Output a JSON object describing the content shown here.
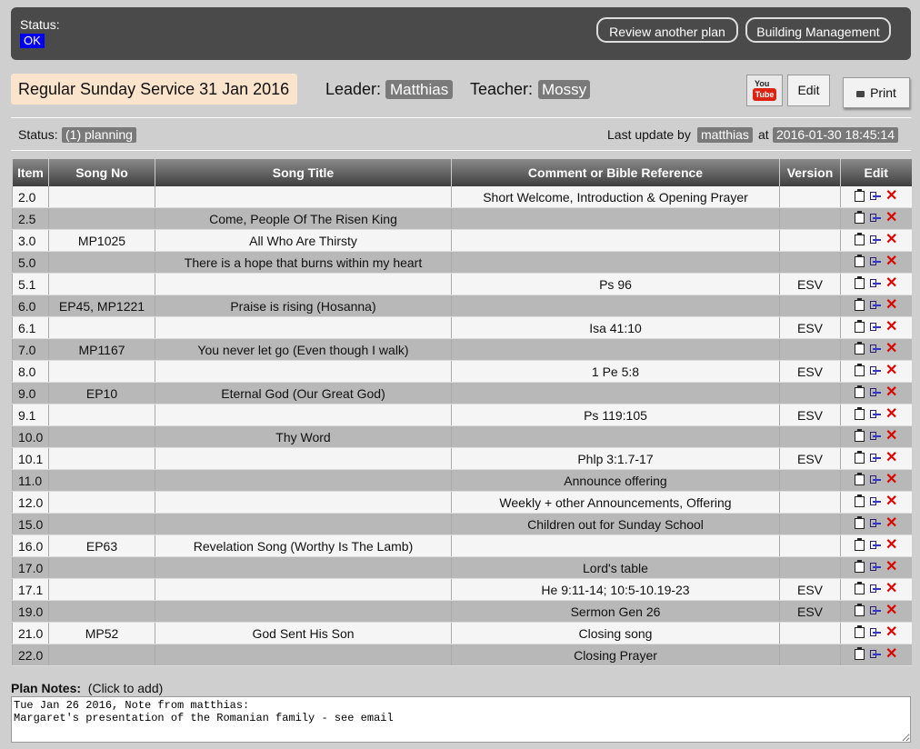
{
  "top": {
    "status_label": "Status:",
    "status_value": "OK",
    "review_button": "Review another plan",
    "building_button": "Building Management"
  },
  "header": {
    "service_title": "Regular Sunday Service 31 Jan 2016",
    "leader_label": "Leader:",
    "leader": "Matthias",
    "teacher_label": "Teacher:",
    "teacher": "Mossy",
    "youtube_icon_top": "You",
    "youtube_icon_bottom": "Tube",
    "edit_button": "Edit",
    "print_button": "Print"
  },
  "status_bar": {
    "label": "Status:",
    "value": "(1) planning",
    "last_update_label": "Last update by",
    "last_update_user": "matthias",
    "at_label": "at",
    "last_update_time": "2016-01-30 18:45:14"
  },
  "table": {
    "headers": [
      "Item",
      "Song No",
      "Song Title",
      "Comment or Bible Reference",
      "Version",
      "Edit"
    ],
    "rows": [
      {
        "item": "2.0",
        "song_no": "",
        "title": "",
        "comment": "Short Welcome, Introduction & Opening Prayer",
        "version": ""
      },
      {
        "item": "2.5",
        "song_no": "",
        "title": "Come, People Of The Risen King",
        "comment": "",
        "version": ""
      },
      {
        "item": "3.0",
        "song_no": "MP1025",
        "title": "All Who Are Thirsty",
        "comment": "",
        "version": ""
      },
      {
        "item": "5.0",
        "song_no": "",
        "title": "There is a hope that burns within my heart",
        "comment": "",
        "version": ""
      },
      {
        "item": "5.1",
        "song_no": "",
        "title": "",
        "comment": "Ps 96",
        "version": "ESV"
      },
      {
        "item": "6.0",
        "song_no": "EP45, MP1221",
        "title": "Praise is rising (Hosanna)",
        "comment": "",
        "version": ""
      },
      {
        "item": "6.1",
        "song_no": "",
        "title": "",
        "comment": "Isa 41:10",
        "version": "ESV"
      },
      {
        "item": "7.0",
        "song_no": "MP1167",
        "title": "You never let go (Even though I walk)",
        "comment": "",
        "version": ""
      },
      {
        "item": "8.0",
        "song_no": "",
        "title": "",
        "comment": "1 Pe 5:8",
        "version": "ESV"
      },
      {
        "item": "9.0",
        "song_no": "EP10",
        "title": "Eternal God (Our Great God)",
        "comment": "",
        "version": ""
      },
      {
        "item": "9.1",
        "song_no": "",
        "title": "",
        "comment": "Ps 119:105",
        "version": "ESV"
      },
      {
        "item": "10.0",
        "song_no": "",
        "title": "Thy Word",
        "comment": "",
        "version": ""
      },
      {
        "item": "10.1",
        "song_no": "",
        "title": "",
        "comment": "Phlp 3:1.7-17",
        "version": "ESV"
      },
      {
        "item": "11.0",
        "song_no": "",
        "title": "",
        "comment": "Announce offering",
        "version": ""
      },
      {
        "item": "12.0",
        "song_no": "",
        "title": "",
        "comment": "Weekly + other Announcements, Offering",
        "version": ""
      },
      {
        "item": "15.0",
        "song_no": "",
        "title": "",
        "comment": "Children out for Sunday School",
        "version": ""
      },
      {
        "item": "16.0",
        "song_no": "EP63",
        "title": "Revelation Song (Worthy Is The Lamb)",
        "comment": "",
        "version": ""
      },
      {
        "item": "17.0",
        "song_no": "",
        "title": "",
        "comment": "Lord's table",
        "version": ""
      },
      {
        "item": "17.1",
        "song_no": "",
        "title": "",
        "comment": "He 9:11-14; 10:5-10.19-23",
        "version": "ESV"
      },
      {
        "item": "19.0",
        "song_no": "",
        "title": "",
        "comment": "Sermon Gen 26",
        "version": "ESV"
      },
      {
        "item": "21.0",
        "song_no": "MP52",
        "title": "God Sent His Son",
        "comment": "Closing song",
        "version": ""
      },
      {
        "item": "22.0",
        "song_no": "",
        "title": "",
        "comment": "Closing Prayer",
        "version": ""
      }
    ],
    "edit_icons": [
      "clipboard-icon",
      "split-icon",
      "delete-icon"
    ],
    "delete_glyph": "✕"
  },
  "notes": {
    "label": "Plan Notes:",
    "hint": "(Click to add)",
    "text": "Tue Jan 26 2016, Note from matthias:\nMargaret's presentation of the Romanian family - see email"
  },
  "colors": {
    "topbar": "#4a4a4a",
    "ok_badge": "#0000ee",
    "title_bg": "#fbe4cc",
    "badge": "#7a7a7a",
    "row_odd": "#f5f5f5",
    "row_even": "#b8b8b8",
    "delete": "#dd0000"
  }
}
